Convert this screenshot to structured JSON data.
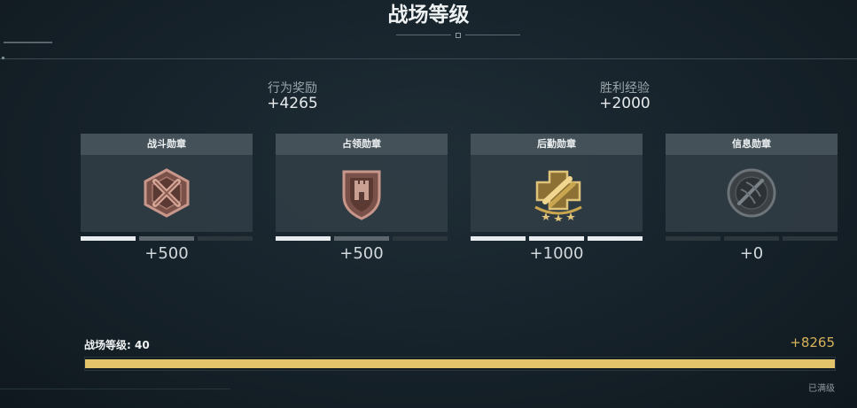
{
  "page": {
    "title": "战场等级"
  },
  "summary": [
    {
      "label": "行为奖励",
      "value": "+4265"
    },
    {
      "label": "胜利经验",
      "value": "+2000"
    }
  ],
  "medals": [
    {
      "name": "战斗勋章",
      "icon": "crossed-swords-medal-icon",
      "segments": [
        "full",
        "half",
        "empty"
      ],
      "score": "+500",
      "color": "#a8766a"
    },
    {
      "name": "占领勋章",
      "icon": "fortress-shield-medal-icon",
      "segments": [
        "full",
        "half",
        "empty"
      ],
      "score": "+500",
      "color": "#a8766a"
    },
    {
      "name": "后勤勋章",
      "icon": "supply-cross-medal-icon",
      "segments": [
        "full",
        "full",
        "full"
      ],
      "score": "+1000",
      "color": "#c9a64f"
    },
    {
      "name": "信息勋章",
      "icon": "radar-medal-icon",
      "segments": [
        "empty",
        "empty",
        "empty"
      ],
      "score": "+0",
      "color": "#5a6166"
    }
  ],
  "level": {
    "label": "战场等级: 40",
    "total": "+8265",
    "progress": 1.0,
    "status": "已满级",
    "color": "#e3c46a"
  }
}
